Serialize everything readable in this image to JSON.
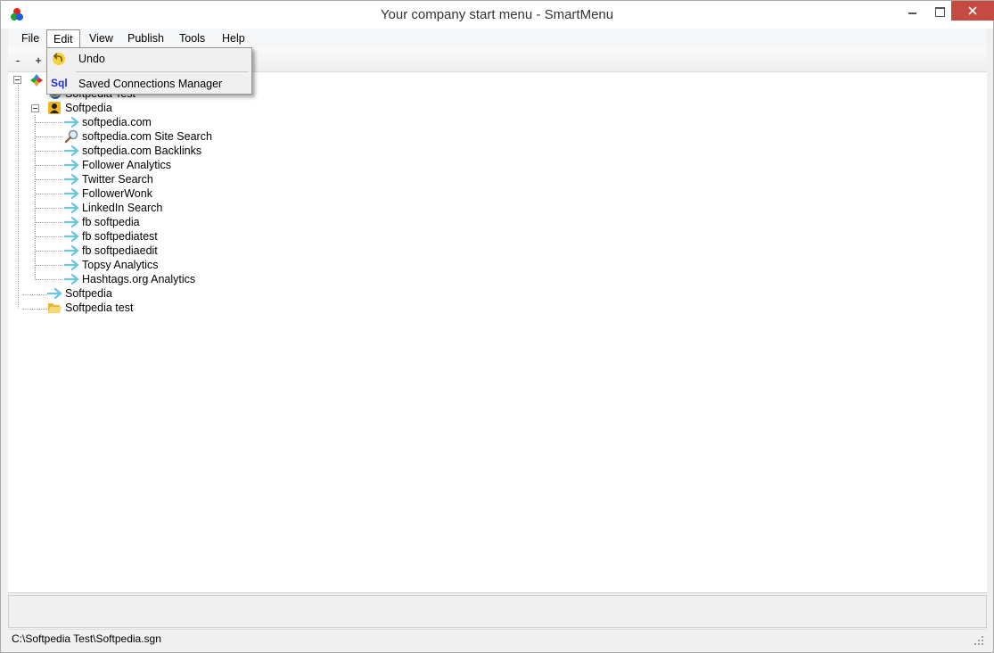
{
  "window": {
    "title": "Your company start menu - SmartMenu",
    "accent_close": "#c74a42"
  },
  "menubar": {
    "items": [
      "File",
      "Edit",
      "View",
      "Publish",
      "Tools",
      "Help"
    ]
  },
  "toolbar": {
    "collapse_label": "-",
    "expand_label": "+"
  },
  "edit_menu": {
    "undo_label": "Undo",
    "saved_connections_label": "Saved Connections Manager",
    "sql_icon_text": "Sql"
  },
  "tree": {
    "root_partial_label": "Softpedia Test",
    "group_label": "Softpedia",
    "children": [
      "softpedia.com",
      "softpedia.com Site Search",
      "softpedia.com Backlinks",
      "Follower Analytics",
      "Twitter Search",
      "FollowerWonk",
      "LinkedIn Search",
      "fb softpedia",
      "fb softpediatest",
      "fb softpediaedit",
      "Topsy Analytics",
      "Hashtags.org Analytics"
    ],
    "link_label": "Softpedia",
    "folder_label": "Softpedia test"
  },
  "statusbar": {
    "path": "C:\\Softpedia Test\\Softpedia.sgn"
  }
}
